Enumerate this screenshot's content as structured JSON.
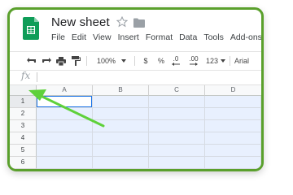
{
  "app": {
    "title": "New sheet",
    "accent": "#5aa02c",
    "logo_color": "#0f9d58"
  },
  "menu": [
    "File",
    "Edit",
    "View",
    "Insert",
    "Format",
    "Data",
    "Tools",
    "Add-ons"
  ],
  "toolbar": {
    "zoom": "100%",
    "currency": "$",
    "percent": "%",
    "decrease_decimal": ".0",
    "increase_decimal": ".00",
    "more_formats": "123",
    "font": "Arial"
  },
  "formula_bar": {
    "label": "fx",
    "value": ""
  },
  "grid": {
    "columns": [
      "A",
      "B",
      "C",
      "D"
    ],
    "rows": [
      "1",
      "2",
      "3",
      "4",
      "5",
      "6"
    ],
    "selected_cell": "A1",
    "selection_color": "#e8f0fe",
    "active_border": "#1a73e8"
  },
  "annotation": {
    "arrow_color": "#5fd13b"
  }
}
